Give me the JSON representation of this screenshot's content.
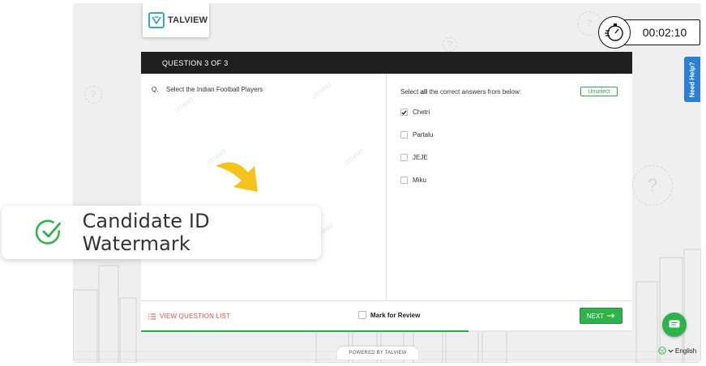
{
  "brand": {
    "name": "TALVIEW"
  },
  "timer": {
    "value": "00:02:10"
  },
  "help": {
    "label": "Need Help?"
  },
  "question": {
    "header": "QUESTION 3 OF 3",
    "number": "Q.",
    "text": "Select the Indian Football Players",
    "instruction_pre": "Select ",
    "instruction_bold": "all",
    "instruction_post": " the correct answers from below:",
    "unselect_label": "Unselect",
    "options": [
      {
        "label": "Chetri",
        "checked": true
      },
      {
        "label": "Partalu",
        "checked": false
      },
      {
        "label": "JEJE",
        "checked": false
      },
      {
        "label": "Miku",
        "checked": false
      }
    ],
    "watermark": "2374583"
  },
  "footer": {
    "view_list_label": "VIEW QUESTION LIST",
    "mark_review_label": "Mark for Review",
    "next_label": "NEXT",
    "progress_fraction": 0.667
  },
  "powered_by": "POWERED BY TALVIEW",
  "language": {
    "label": "English"
  },
  "badge": {
    "text": "Candidate ID Watermark"
  },
  "colors": {
    "accent_green": "#2eb34a",
    "header_dark": "#1f1f1f",
    "help_blue": "#2b7fd4",
    "danger_red": "#d9534f",
    "arrow_yellow": "#f6c21c"
  },
  "icons": [
    "talview-logo-icon",
    "stopwatch-icon",
    "list-icon",
    "arrow-right-icon",
    "chat-icon",
    "globe-icon",
    "chevron-down-icon",
    "check-circle-icon",
    "curved-arrow-icon",
    "checkmark-icon"
  ]
}
